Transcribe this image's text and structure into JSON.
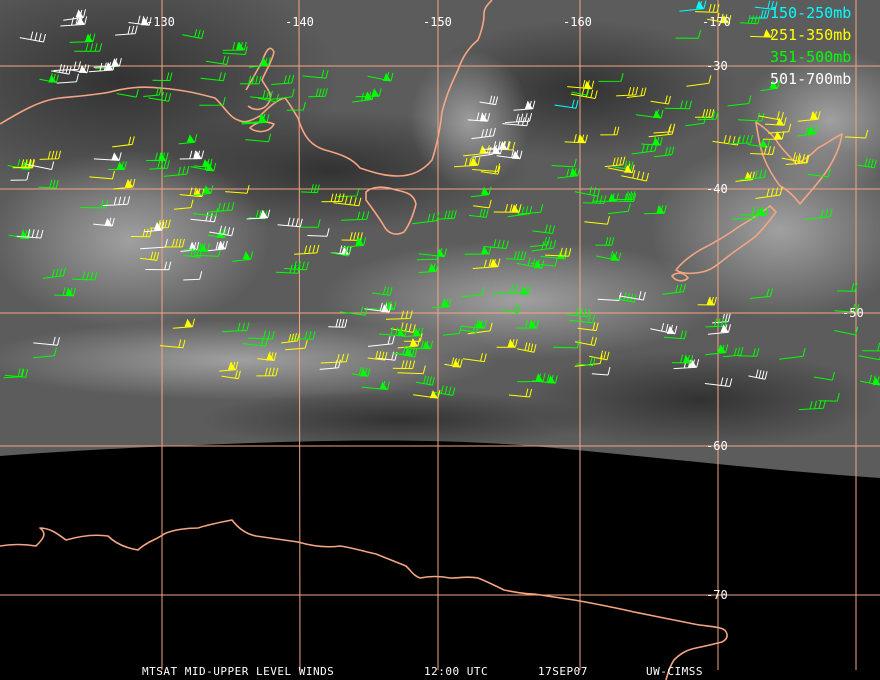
{
  "longitude_labels": [
    "-130",
    "-140",
    "-150",
    "-160",
    "-170"
  ],
  "latitude_labels": [
    "-30",
    "-40",
    "-50",
    "-60",
    "-70"
  ],
  "legend": [
    {
      "label": "150-250mb",
      "color": "#00ffff"
    },
    {
      "label": "251-350mb",
      "color": "#ffff00"
    },
    {
      "label": "351-500mb",
      "color": "#00ff00"
    },
    {
      "label": "501-700mb",
      "color": "#ffffff"
    }
  ],
  "footer": {
    "product": "MTSAT MID-UPPER LEVEL WINDS",
    "time": "12:00 UTC",
    "date": "17SEP07",
    "source": "UW-CIMSS"
  },
  "colors": {
    "coastline": "#f4a582",
    "grid": "#f4a582",
    "background": "#000000"
  }
}
